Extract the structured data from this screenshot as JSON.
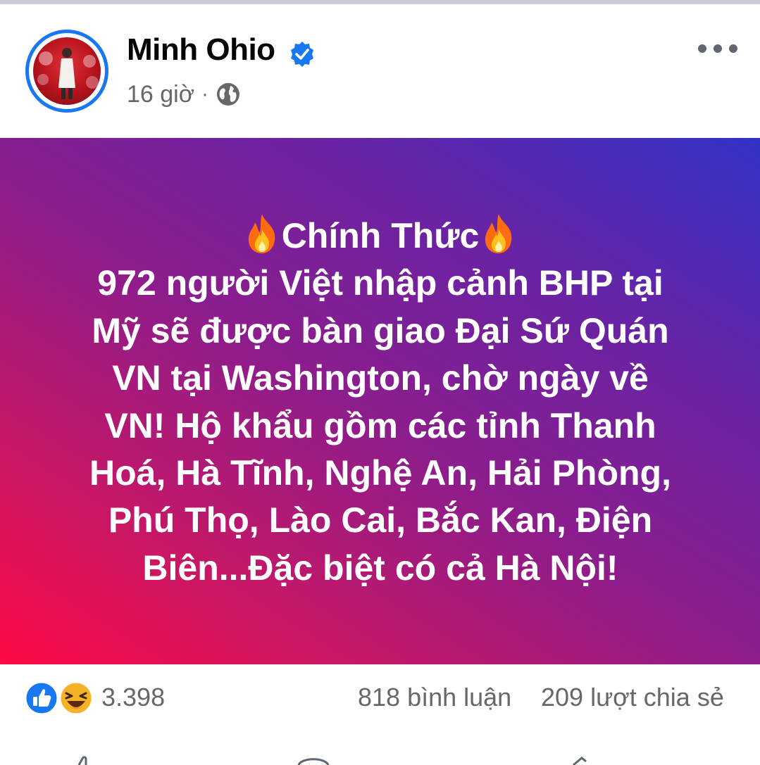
{
  "post": {
    "author": "Minh Ohio",
    "time": "16 giờ",
    "separator": "·",
    "title": "Chính Thức",
    "body_lines": [
      "972 người Việt nhập cảnh BHP tại",
      "Mỹ sẽ được bàn giao Đại Sứ Quán",
      "VN tại Washington, chờ ngày về",
      "VN! Hộ khẩu gồm các tỉnh Thanh",
      "Hoá, Hà Tĩnh, Nghệ An, Hải Phòng,",
      "Phú Thọ, Lào Cai, Bắc Kan, Điện",
      "Biên...Đặc biệt có cả Hà Nội!"
    ]
  },
  "stats": {
    "reaction_count": "3.398",
    "comments": "818 bình luận",
    "shares": "209 lượt chia sẻ"
  },
  "icons": {
    "verified": "verified-badge-icon",
    "audience": "globe-icon",
    "more": "more-options-icon",
    "title_emoji": "fire-icon",
    "reactions": [
      "like-icon",
      "haha-icon"
    ]
  },
  "colors": {
    "accent": "#1877f2",
    "text_primary": "#050505",
    "text_secondary": "#65676b",
    "gradient_start": "#ff0a46",
    "gradient_end": "#3332c6"
  }
}
